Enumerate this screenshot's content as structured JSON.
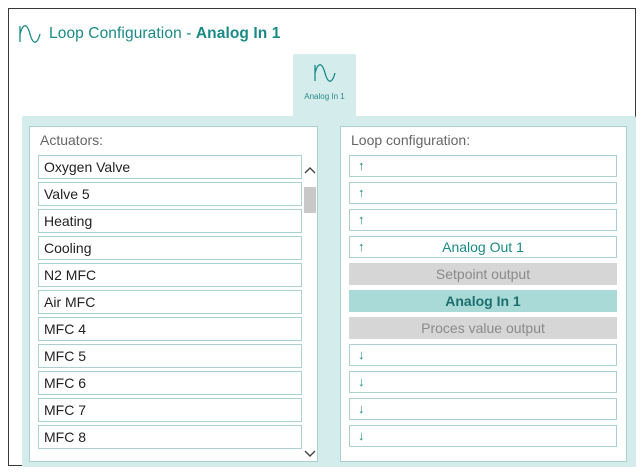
{
  "header": {
    "icon": "sine-wave-icon",
    "title_prefix": "Loop Configuration - ",
    "title_name": "Analog In 1"
  },
  "tab": {
    "icon": "sine-wave-icon",
    "label": "Analog In 1"
  },
  "actuators": {
    "title": "Actuators:",
    "items": [
      "Oxygen Valve",
      "Valve 5",
      "Heating",
      "Cooling",
      "N2 MFC",
      "Air MFC",
      "MFC 4",
      "MFC 5",
      "MFC 6",
      "MFC 7",
      "MFC 8"
    ]
  },
  "loop": {
    "title": "Loop configuration:",
    "items": [
      {
        "arrow": "↑",
        "label": "",
        "state": "normal"
      },
      {
        "arrow": "↑",
        "label": "",
        "state": "normal"
      },
      {
        "arrow": "↑",
        "label": "",
        "state": "normal"
      },
      {
        "arrow": "↑",
        "label": "Analog Out 1",
        "state": "normal"
      },
      {
        "arrow": "",
        "label": "Setpoint output",
        "state": "gray"
      },
      {
        "arrow": "",
        "label": "Analog In 1",
        "state": "active"
      },
      {
        "arrow": "",
        "label": "Proces value output",
        "state": "gray"
      },
      {
        "arrow": "↓",
        "label": "",
        "state": "normal"
      },
      {
        "arrow": "↓",
        "label": "",
        "state": "normal"
      },
      {
        "arrow": "↓",
        "label": "",
        "state": "normal"
      },
      {
        "arrow": "↓",
        "label": "",
        "state": "normal"
      }
    ]
  },
  "colors": {
    "accent": "#1a8a87",
    "panel_bg": "#d4ecec",
    "border": "#a9d1d0",
    "active_bg": "#a9dad8",
    "disabled_bg": "#d6d6d6"
  }
}
